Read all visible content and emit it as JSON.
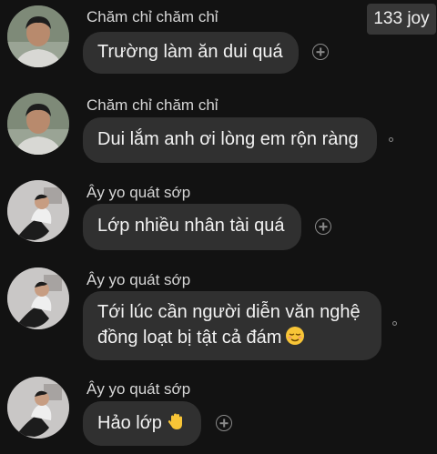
{
  "badge": {
    "label": "133 joy"
  },
  "messages": [
    {
      "sender": "Chăm chỉ chăm chỉ",
      "lines": [
        "Trường làm ăn dui quá"
      ],
      "emoji": ""
    },
    {
      "sender": "Chăm chỉ chăm chỉ",
      "lines": [
        "Dui lắm anh ơi lòng em rộn ràng"
      ],
      "emoji": ""
    },
    {
      "sender": "Ây yo quát sớp",
      "lines": [
        "Lớp nhiều nhân tài quá"
      ],
      "emoji": ""
    },
    {
      "sender": "Ây yo quát sớp",
      "lines": [
        "Tới lúc cần người diễn văn nghệ",
        "đồng loạt bị tật cả đám"
      ],
      "emoji": "relieved-face"
    },
    {
      "sender": "Ây yo quát sớp",
      "lines": [
        "Hảo lớp"
      ],
      "emoji": "waving-hand"
    }
  ],
  "colors": {
    "background": "#121212",
    "bubble": "#303030",
    "bubble_text": "#f2f2f2",
    "sender_text": "#d6d6d6",
    "icon": "#8a8a8a"
  }
}
